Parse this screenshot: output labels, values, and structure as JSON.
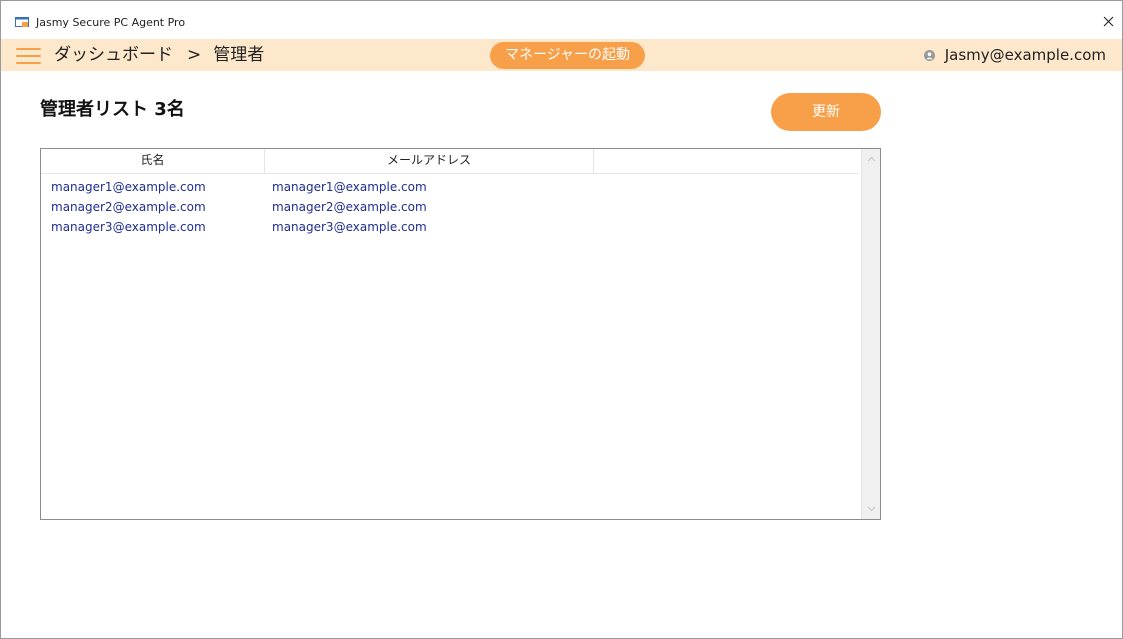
{
  "window": {
    "title": "Jasmy Secure PC Agent Pro"
  },
  "navbar": {
    "breadcrumb_home": "ダッシュボード",
    "breadcrumb_separator": ">",
    "breadcrumb_current": "管理者",
    "launch_button": "マネージャーの起動",
    "user_email": "Jasmy@example.com"
  },
  "main": {
    "list_title": "管理者リスト 3名",
    "refresh_button": "更新",
    "columns": [
      "氏名",
      "メールアドレス",
      ""
    ],
    "rows": [
      {
        "name": "manager1@example.com",
        "email": "manager1@example.com"
      },
      {
        "name": "manager2@example.com",
        "email": "manager2@example.com"
      },
      {
        "name": "manager3@example.com",
        "email": "manager3@example.com"
      }
    ]
  },
  "colors": {
    "accent": "#f7a049",
    "navbar_bg": "#fde8cc",
    "link_text": "#1f2d8f"
  },
  "icons": {
    "app": "app-window-icon",
    "menu": "hamburger-menu-icon",
    "user": "user-icon",
    "close": "close-icon",
    "scroll_up": "chevron-up-icon",
    "scroll_down": "chevron-down-icon"
  }
}
